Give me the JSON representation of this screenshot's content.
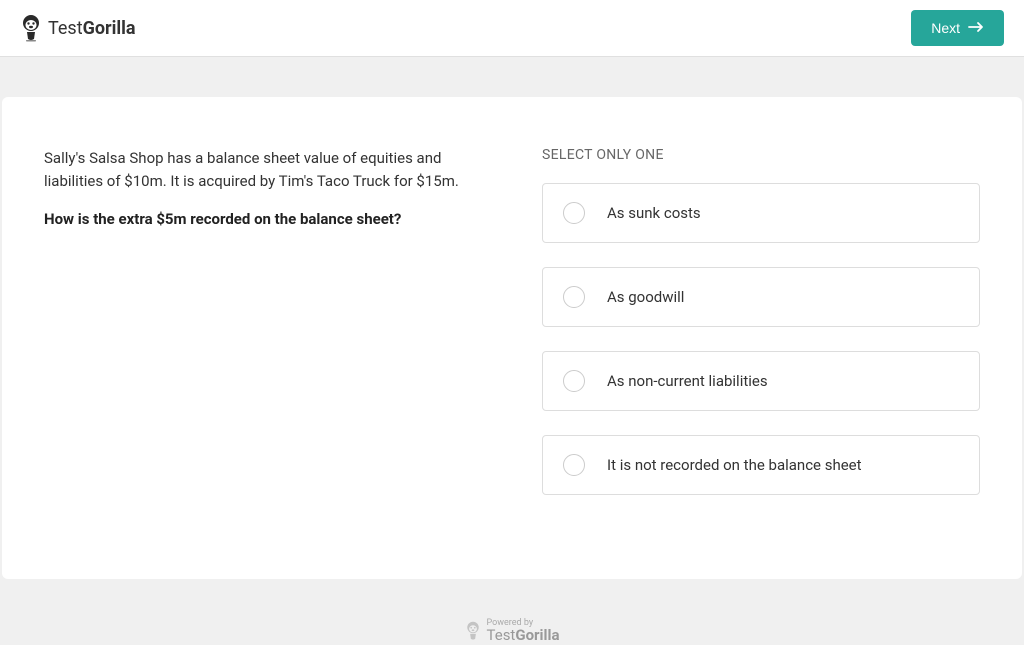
{
  "header": {
    "brand_light": "Test",
    "brand_bold": "Gorilla",
    "next_label": "Next"
  },
  "question": {
    "intro": "Sally's Salsa Shop has a balance sheet value of equities and liabilities of $10m. It is acquired by Tim's Taco Truck for $15m.",
    "prompt": "How is the extra $5m recorded on the balance sheet?"
  },
  "answers": {
    "instruction": "SELECT ONLY ONE",
    "options": [
      "As sunk costs",
      "As goodwill",
      "As non-current liabilities",
      "It is not recorded on the balance sheet"
    ]
  },
  "footer": {
    "powered_by": "Powered by",
    "brand_light": "Test",
    "brand_bold": "Gorilla"
  }
}
